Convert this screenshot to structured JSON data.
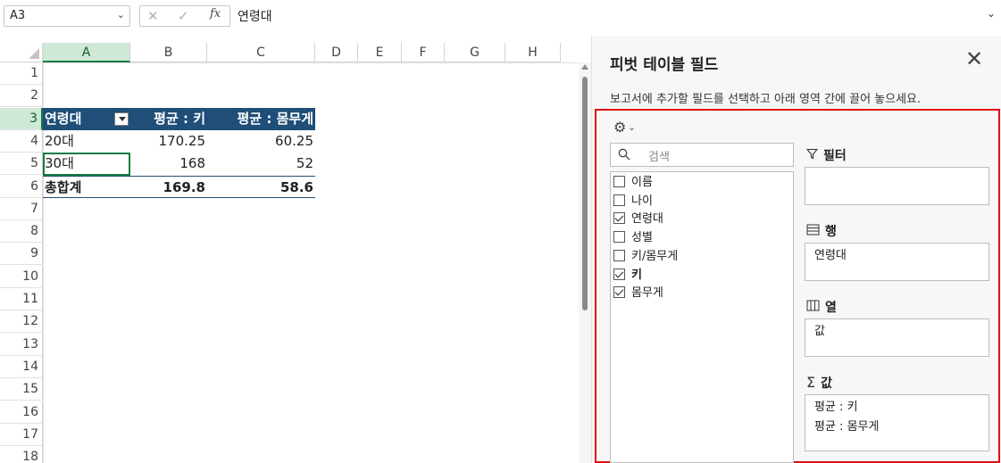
{
  "formula_bar": {
    "name_box": "A3",
    "formula": "연령대",
    "cancel_icon": "✕",
    "enter_icon": "✓",
    "fx_label": "fx"
  },
  "sheet": {
    "columns": [
      "A",
      "B",
      "C",
      "D",
      "E",
      "F",
      "G",
      "H"
    ],
    "selected_column": "A",
    "rows": [
      "1",
      "2",
      "3",
      "4",
      "5",
      "6",
      "7",
      "8",
      "9",
      "10",
      "11",
      "12",
      "13",
      "14",
      "15",
      "16",
      "17",
      "18"
    ],
    "selected_row": "3",
    "pivot": {
      "header": [
        "연령대",
        "평균 : 키",
        "평균 : 몸무게"
      ],
      "rows": [
        [
          "20대",
          "170.25",
          "60.25"
        ],
        [
          "30대",
          "168",
          "52"
        ]
      ],
      "total": [
        "총합계",
        "169.8",
        "58.6"
      ]
    }
  },
  "pane": {
    "title": "피벗 테이블 필드",
    "description": "보고서에 추가할 필드를 선택하고 아래 영역 간에 끌어 놓으세요.",
    "search_placeholder": "검색",
    "fields": [
      {
        "label": "이름",
        "checked": false
      },
      {
        "label": "나이",
        "checked": false
      },
      {
        "label": "연령대",
        "checked": true
      },
      {
        "label": "성별",
        "checked": false
      },
      {
        "label": "키/몸무게",
        "checked": false
      },
      {
        "label": "키",
        "checked": true
      },
      {
        "label": "몸무게",
        "checked": true
      }
    ],
    "areas": {
      "filter": {
        "label": "필터",
        "items": []
      },
      "rows": {
        "label": "행",
        "items": [
          "연령대"
        ]
      },
      "columns": {
        "label": "열",
        "items": [
          "값"
        ]
      },
      "values": {
        "label": "값",
        "items": [
          "평균 : 키",
          "평균 : 몸무게"
        ]
      }
    }
  },
  "colors": {
    "pivot_header": "#1f4e78",
    "selection": "#107c41",
    "highlight_border": "#e01010"
  }
}
